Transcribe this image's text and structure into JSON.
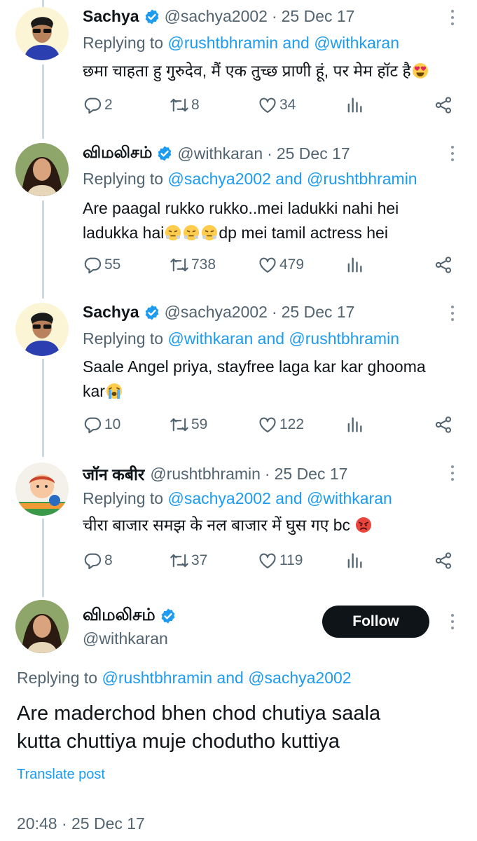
{
  "tweets": [
    {
      "name": "Sachya",
      "handle": "@sachya2002",
      "date": "25 Dec 17",
      "replying_prefix": "Replying to ",
      "replying_a": "@rushtbhramin",
      "replying_and": " and ",
      "replying_b": "@withkaran",
      "text_1": "छमा चाहता हु गुरुदेव, मैं एक तुच्छ प्राणी हूं, पर मेम हॉट है",
      "emoji": "heart-eyes",
      "replies": "2",
      "retweets": "8",
      "likes": "34"
    },
    {
      "name": "விமலிசம்",
      "handle": "@withkaran",
      "date": "25 Dec 17",
      "replying_prefix": "Replying to ",
      "replying_a": "@sachya2002",
      "replying_and": " and ",
      "replying_b": "@rushtbhramin",
      "text_1": "Are paagal rukko rukko..mei ladukki nahi hei",
      "text_2a": "ladukka hai",
      "text_2b": "dp mei tamil actress hei",
      "emoji": "steam-from-nose",
      "replies": "55",
      "retweets": "738",
      "likes": "479"
    },
    {
      "name": "Sachya",
      "handle": "@sachya2002",
      "date": "25 Dec 17",
      "replying_prefix": "Replying to ",
      "replying_a": "@withkaran",
      "replying_and": " and ",
      "replying_b": "@rushtbhramin",
      "text_1": "Saale Angel priya, stayfree laga kar kar ghooma",
      "text_2": "kar",
      "emoji": "loudly-crying",
      "replies": "10",
      "retweets": "59",
      "likes": "122"
    },
    {
      "name": "जॉन कबीर",
      "handle": "@rushtbhramin",
      "date": "25 Dec 17",
      "replying_prefix": "Replying to ",
      "replying_a": "@sachya2002",
      "replying_and": " and ",
      "replying_b": "@withkaran",
      "text_1": "चीरा बाजार समझ के नल बाजार में घुस गए bc",
      "emoji": "angry-face",
      "replies": "8",
      "retweets": "37",
      "likes": "119"
    }
  ],
  "main_tweet": {
    "name": "விமலிசம்",
    "handle": "@withkaran",
    "follow_label": "Follow",
    "replying_prefix": "Replying to ",
    "replying_a": "@rushtbhramin",
    "replying_and": " and ",
    "replying_b": "@sachya2002",
    "text_1": "Are maderchod bhen chod chutiya saala",
    "text_2": "kutta chuttiya muje chodutho kuttiya",
    "translate_label": "Translate post",
    "timestamp": "20:48 · 25 Dec 17"
  },
  "colors": {
    "link": "#1d9bf0",
    "muted": "#536471",
    "verified": "#1d9bf0",
    "text": "#0f1419",
    "follow_bg": "#0f1419"
  },
  "icons": [
    "verified-badge-icon",
    "reply-icon",
    "retweet-icon",
    "like-icon",
    "views-icon",
    "share-icon",
    "more-icon"
  ]
}
